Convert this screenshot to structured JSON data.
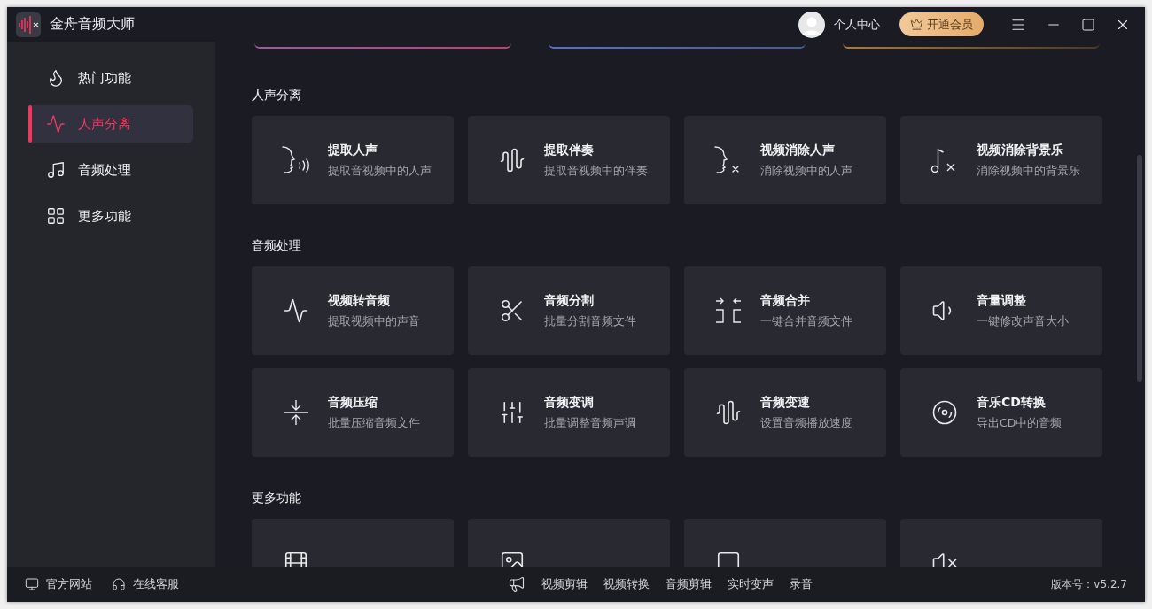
{
  "window": {
    "title": "金舟音频大师"
  },
  "account": {
    "user_label": "个人中心",
    "vip_button": "开通会员"
  },
  "sidebar": {
    "items": [
      {
        "label": "热门功能",
        "selected": false
      },
      {
        "label": "人声分离",
        "selected": true
      },
      {
        "label": "音频处理",
        "selected": false
      },
      {
        "label": "更多功能",
        "selected": false
      }
    ]
  },
  "sections": [
    {
      "title": "人声分离",
      "cards": [
        {
          "title": "提取人声",
          "subtitle": "提取音视频中的人声"
        },
        {
          "title": "提取伴奏",
          "subtitle": "提取音视频中的伴奏"
        },
        {
          "title": "视频消除人声",
          "subtitle": "消除视频中的人声"
        },
        {
          "title": "视频消除背景乐",
          "subtitle": "消除视频中的背景乐"
        }
      ]
    },
    {
      "title": "音频处理",
      "cards": [
        {
          "title": "视频转音频",
          "subtitle": "提取视频中的声音"
        },
        {
          "title": "音频分割",
          "subtitle": "批量分割音频文件"
        },
        {
          "title": "音频合并",
          "subtitle": "一键合并音频文件"
        },
        {
          "title": "音量调整",
          "subtitle": "一键修改声音大小"
        },
        {
          "title": "音频压缩",
          "subtitle": "批量压缩音频文件"
        },
        {
          "title": "音频变调",
          "subtitle": "批量调整音频声调"
        },
        {
          "title": "音频变速",
          "subtitle": "设置音频播放速度"
        },
        {
          "title": "音乐CD转换",
          "subtitle": "导出CD中的音频"
        }
      ]
    },
    {
      "title": "更多功能",
      "cards": [
        {
          "kind": "feature"
        },
        {
          "kind": "feature"
        },
        {
          "kind": "feature"
        },
        {
          "kind": "feature"
        }
      ]
    }
  ],
  "footer": {
    "left_links": [
      "官方网站",
      "在线客服"
    ],
    "tools": [
      "视频剪辑",
      "视频转换",
      "音频剪辑",
      "实时变声",
      "录音"
    ],
    "version": "版本号：v5.2.7"
  }
}
